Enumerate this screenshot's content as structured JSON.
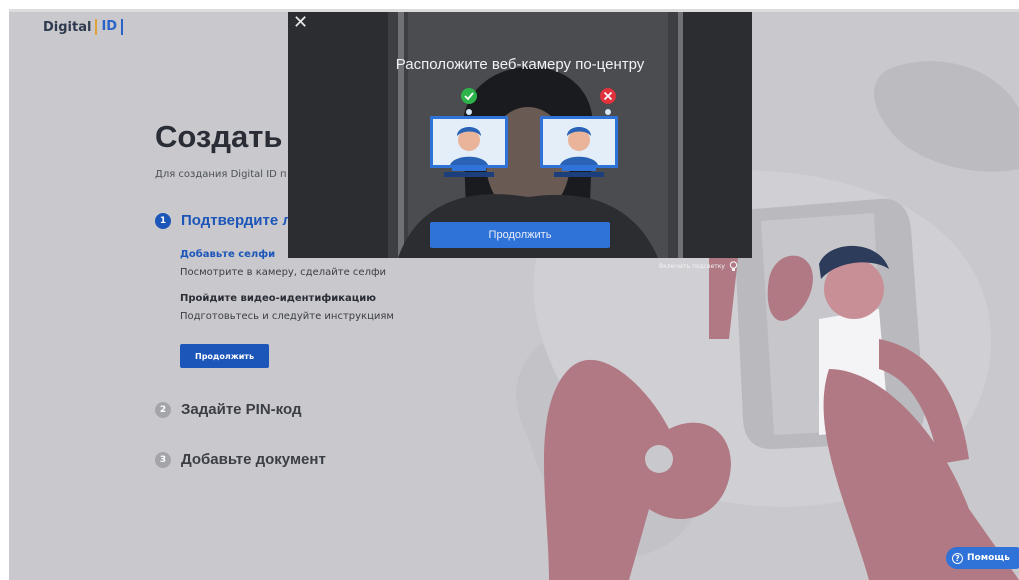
{
  "header": {
    "logo_text": "Digital",
    "logo_box": "ID"
  },
  "main": {
    "title": "Создать",
    "subtitle": "Для создания Digital ID п",
    "steps": [
      {
        "num": "1",
        "label": "Подтвердите л"
      },
      {
        "num": "2",
        "label": "Задайте PIN-код"
      },
      {
        "num": "3",
        "label": "Добавьте документ"
      }
    ],
    "selfie_title": "Добавьте селфи",
    "selfie_desc": "Посмотрите в камеру, сделайте селфи",
    "video_title": "Пройдите видео-идентификацию",
    "video_desc": "Подготовьтесь и следуйте инструкциям",
    "continue_label": "Продолжить"
  },
  "lighting": {
    "label": "Включить подсветку",
    "icon": "lightbulb-icon"
  },
  "help": {
    "label": "Помощь",
    "icon": "question-icon"
  },
  "modal": {
    "close_icon": "close-icon",
    "title": "Расположите веб-камеру по-центру",
    "continue_label": "Продолжить",
    "good_icon": "check-icon",
    "bad_icon": "cross-icon"
  },
  "colors": {
    "accent": "#1c56b8",
    "modal_button": "#2f72d8",
    "good": "#2db34a",
    "bad": "#e0323b"
  }
}
